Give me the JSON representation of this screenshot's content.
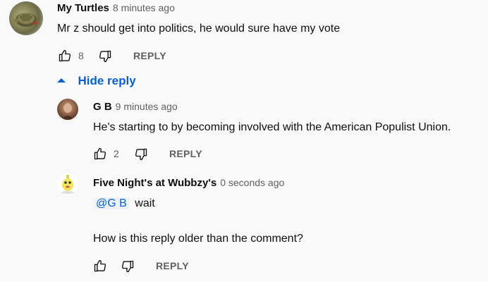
{
  "comment": {
    "author": "My Turtles",
    "time": "8 minutes ago",
    "text": "Mr z should get into politics, he would sure have my vote",
    "likes": "8",
    "reply_label": "REPLY",
    "hide_replies_label": "Hide reply"
  },
  "replies": [
    {
      "author": "G B",
      "time": "9 minutes ago",
      "text": "He's starting to by becoming involved with the American Populist Union.",
      "likes": "2",
      "reply_label": "REPLY"
    },
    {
      "author": "Five Night's at Wubbzy's",
      "time": "0 seconds ago",
      "mention": "@G B",
      "text_line1": "wait",
      "text_line2": "How is this reply older than the comment?",
      "reply_label": "REPLY"
    }
  ],
  "colors": {
    "background": "#f9f9f9",
    "link_blue": "#065fd4",
    "secondary_text": "#606060"
  },
  "icons": [
    "like-icon",
    "dislike-icon",
    "caret-up-icon"
  ]
}
